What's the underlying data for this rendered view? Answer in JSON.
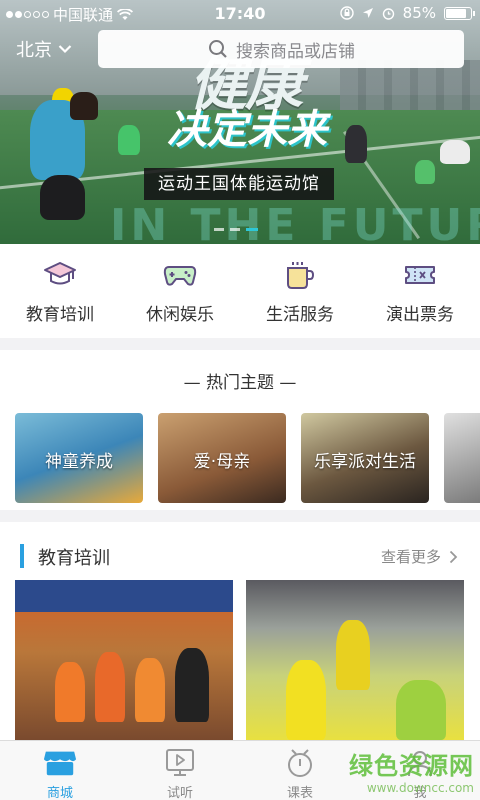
{
  "status_bar": {
    "carrier": "中国联通",
    "time": "17:40",
    "battery": "85%",
    "battery_level": 0.85
  },
  "header": {
    "city": "北京",
    "search_placeholder": "搜索商品或店铺"
  },
  "banner": {
    "title": "健康",
    "subtitle": "决定未来",
    "tag": "运动王国体能运动馆",
    "watermark_text": "IN THE FUTURE",
    "slide_count": 3,
    "active_slide": 3
  },
  "categories": [
    {
      "label": "教育培训",
      "icon": "graduation-cap-icon"
    },
    {
      "label": "休闲娱乐",
      "icon": "gamepad-icon"
    },
    {
      "label": "生活服务",
      "icon": "cup-icon"
    },
    {
      "label": "演出票务",
      "icon": "ticket-icon"
    }
  ],
  "hot_topics": {
    "title": "— 热门主题 —",
    "cards": [
      {
        "label": "神童养成"
      },
      {
        "label": "爱·母亲"
      },
      {
        "label": "乐享派对生活"
      }
    ]
  },
  "education_section": {
    "title": "教育培训",
    "more": "查看更多"
  },
  "tab_bar": [
    {
      "label": "商城",
      "icon": "store-icon",
      "active": true
    },
    {
      "label": "试听",
      "icon": "play-screen-icon",
      "active": false
    },
    {
      "label": "课表",
      "icon": "alarm-clock-icon",
      "active": false
    },
    {
      "label": "我",
      "icon": "person-icon",
      "active": false
    }
  ],
  "watermark": {
    "cn": "绿色资源网",
    "url": "www.downcc.com"
  },
  "colors": {
    "accent": "#2aa0e0",
    "icon_purple": "#6a5a8c"
  }
}
